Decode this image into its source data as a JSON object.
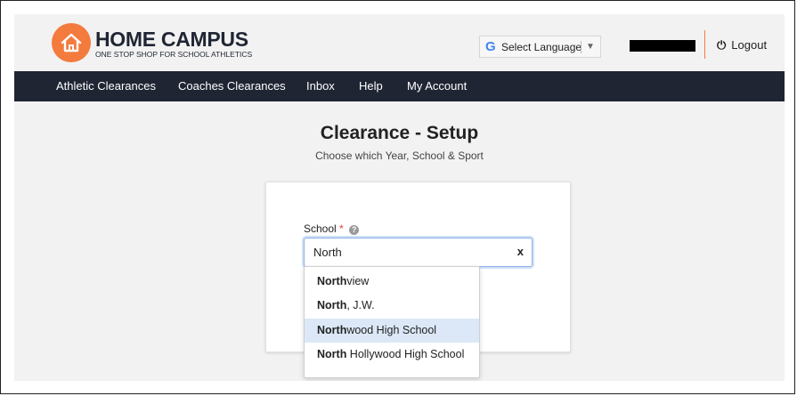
{
  "header": {
    "logo_title": "HOME CAMPUS",
    "logo_subtitle": "ONE STOP SHOP FOR SCHOOL ATHLETICS",
    "language_label": "Select Language",
    "logout_label": "Logout"
  },
  "nav": {
    "items": [
      "Athletic Clearances",
      "Coaches Clearances",
      "Inbox",
      "Help",
      "My Account"
    ]
  },
  "page": {
    "title": "Clearance - Setup",
    "subtitle": "Choose which Year, School & Sport"
  },
  "form": {
    "school_label": "School",
    "required_mark": "*",
    "school_value": "North",
    "clear_label": "x"
  },
  "dropdown": {
    "options": [
      {
        "match": "North",
        "rest": "view"
      },
      {
        "match": "North",
        "rest": ", J.W."
      },
      {
        "match": "North",
        "rest": "wood High School"
      },
      {
        "match": "North",
        "rest": " Hollywood High School"
      }
    ],
    "highlighted_index": 2
  },
  "colors": {
    "accent": "#f47b3e",
    "nav_bg": "#1f2533",
    "highlight": "#dce8f7"
  },
  "icons": {
    "logo": "house-icon",
    "logout": "power-icon",
    "help": "question-circle-icon",
    "language": "google-g-icon"
  }
}
